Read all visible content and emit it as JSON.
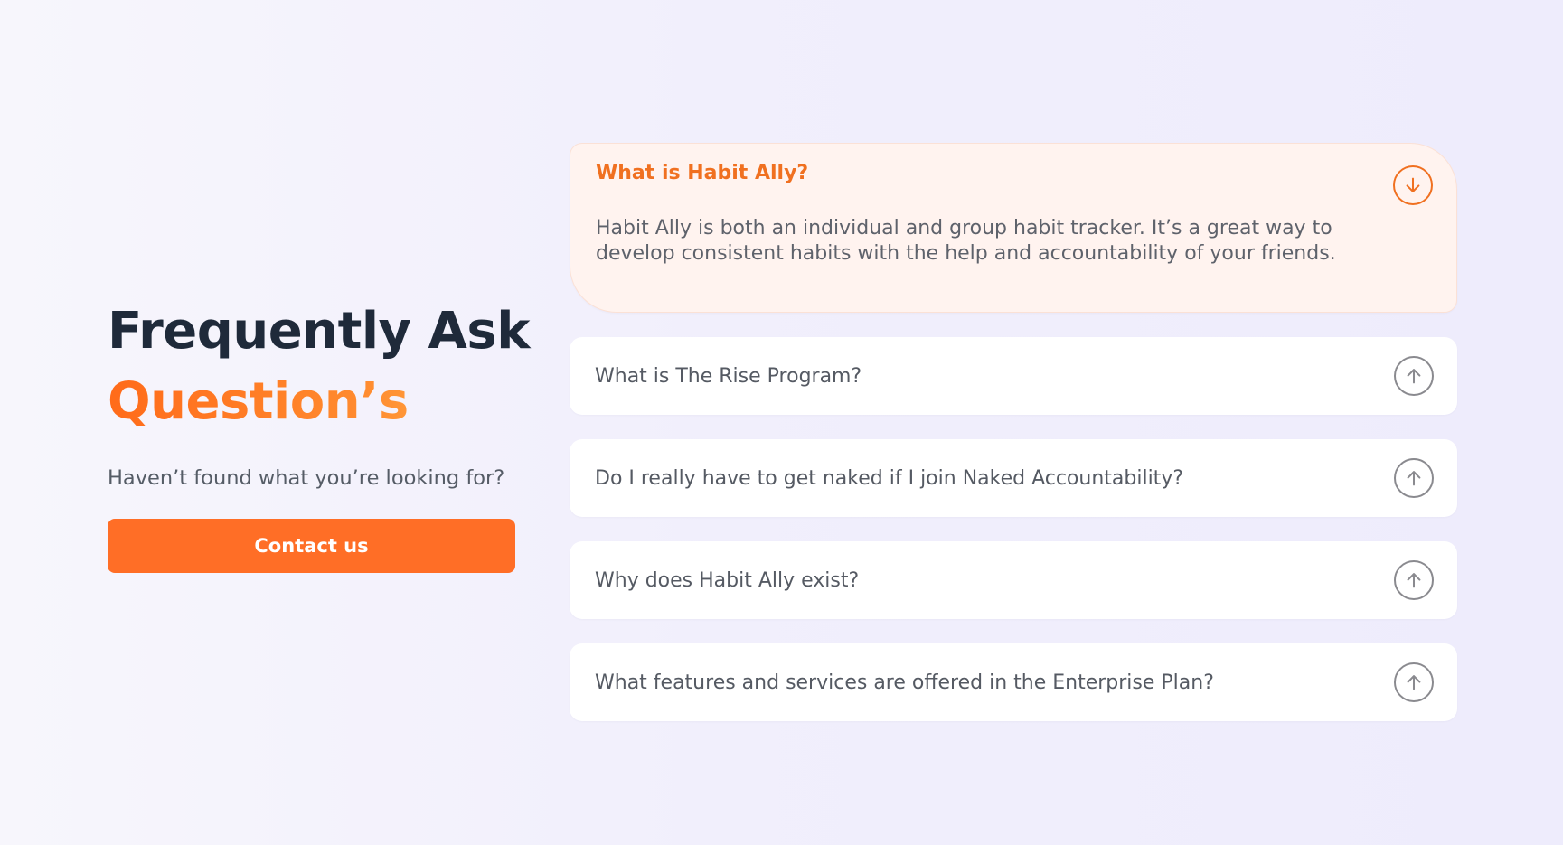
{
  "hero": {
    "title_line1": "Frequently Ask",
    "title_line2": "Question’s",
    "subtitle": "Haven’t found what you’re looking for?",
    "contact_button": "Contact us"
  },
  "faq": {
    "items": [
      {
        "question": "What is Habit Ally?",
        "answer": "Habit Ally is both an individual and group habit tracker. It’s a great way to develop consistent habits with the help and accountability of your friends.",
        "expanded": true,
        "icon": "arrow-down-circle-icon"
      },
      {
        "question": "What is The Rise Program?",
        "expanded": false,
        "icon": "arrow-up-circle-icon"
      },
      {
        "question": "Do I really have to get naked if I join Naked Accountability?",
        "expanded": false,
        "icon": "arrow-up-circle-icon"
      },
      {
        "question": "Why does Habit Ally exist?",
        "expanded": false,
        "icon": "arrow-up-circle-icon"
      },
      {
        "question": "What features and services are offered in the Enterprise Plan?",
        "expanded": false,
        "icon": "arrow-up-circle-icon"
      }
    ]
  },
  "colors": {
    "accent": "#ff6e26",
    "heading_dark": "#1f2a3a",
    "open_panel_bg": "#fff3ef",
    "page_bg": "#f1effc"
  }
}
